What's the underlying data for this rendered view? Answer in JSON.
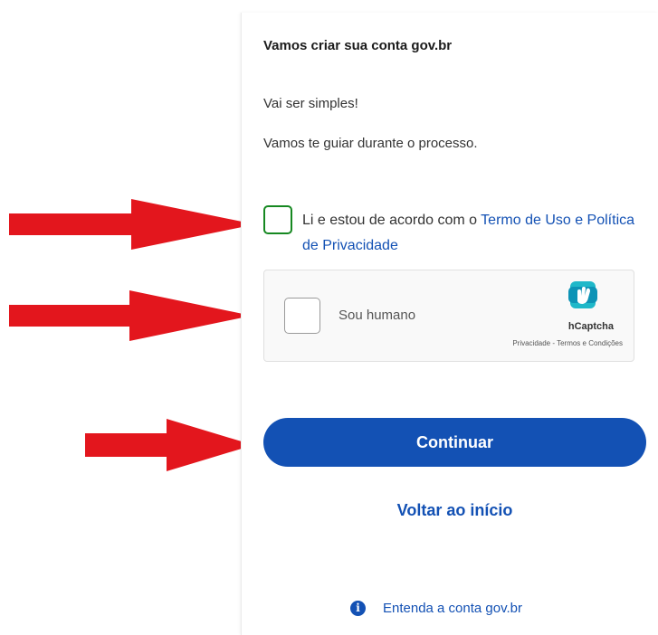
{
  "form": {
    "title": "Vamos criar sua conta gov.br",
    "intro_line_1": "Vai ser simples!",
    "intro_line_2": "Vamos te guiar durante o processo.",
    "terms_prefix": "Li e estou de acordo com o ",
    "terms_link": "Termo de Uso e Política de Privacidade",
    "terms_checked": false
  },
  "captcha": {
    "label": "Sou humano",
    "brand": "hCaptcha",
    "footer": "Privacidade - Termos e Condições",
    "checked": false,
    "logo_icon": "hcaptcha-hand-icon"
  },
  "actions": {
    "continue_label": "Continuar",
    "back_label": "Voltar ao início"
  },
  "help": {
    "icon": "info-icon",
    "label": "Entenda a conta gov.br"
  },
  "annotations": {
    "arrow_icon": "red-arrow-icon",
    "arrow_color": "#e3161d"
  },
  "colors": {
    "primary": "#1351b4",
    "checkbox_border": "#168821",
    "text": "#333333"
  }
}
